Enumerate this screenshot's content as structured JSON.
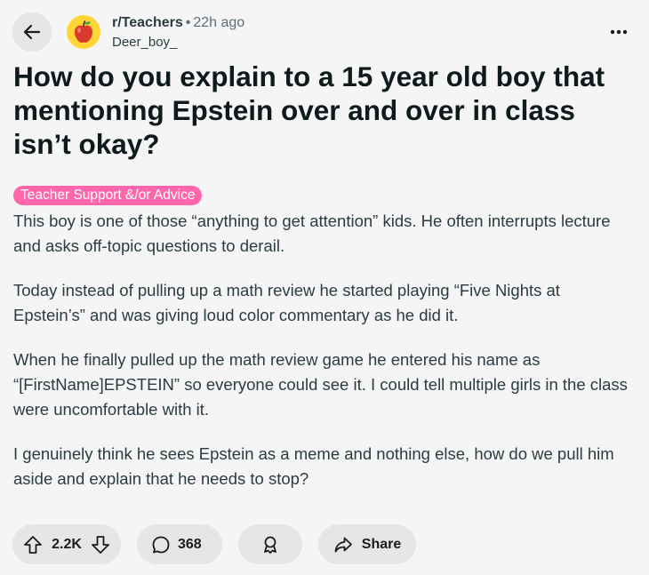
{
  "header": {
    "subreddit": "r/Teachers",
    "separator": "•",
    "time": "22h ago",
    "author": "Deer_boy_",
    "more_label": "•••"
  },
  "post": {
    "title": "How do you explain to a 15 year old boy that mentioning Epstein over and over in class isn’t okay?",
    "flair": "Teacher Support &/or Advice",
    "paragraphs": [
      "This boy is one of those “anything to get attention” kids. He often interrupts lecture and asks off-topic questions to derail.",
      "Today instead of pulling up a math review he started playing “Five Nights at Epstein’s” and was giving loud color commentary as he did it.",
      "When he finally pulled up the math review game he entered his name as “[FirstName]EPSTEIN” so everyone could see it. I could tell multiple girls in the class were uncomfortable with it.",
      "I genuinely think he sees Epstein as a meme and nothing else, how do we pull him aside and explain that he needs to stop?"
    ]
  },
  "actions": {
    "votes": "2.2K",
    "comments": "368",
    "share_label": "Share"
  },
  "colors": {
    "background": "#f5f5f6",
    "pill": "#e4e6e8",
    "flair": "#ff66ac",
    "avatar": "#ffd635"
  },
  "icons": [
    "back-arrow-icon",
    "apple-icon",
    "more-icon",
    "upvote-icon",
    "downvote-icon",
    "comment-icon",
    "award-icon",
    "share-icon"
  ]
}
